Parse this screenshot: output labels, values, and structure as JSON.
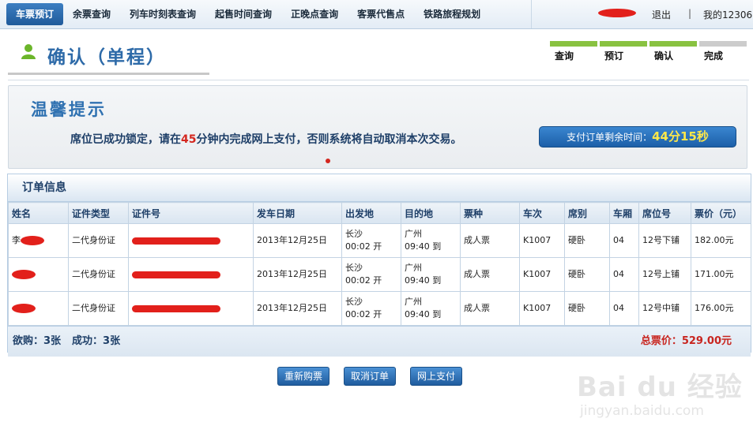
{
  "nav": {
    "items": [
      {
        "label": "车票预订",
        "active": true
      },
      {
        "label": "余票查询",
        "active": false
      },
      {
        "label": "列车时刻表查询",
        "active": false
      },
      {
        "label": "起售时间查询",
        "active": false
      },
      {
        "label": "正晚点查询",
        "active": false
      },
      {
        "label": "客票代售点",
        "active": false
      },
      {
        "label": "铁路旅程规划",
        "active": false
      }
    ],
    "logout": "退出",
    "separator": "|",
    "my": "我的12306"
  },
  "header": {
    "title": "确认（单程）",
    "steps": [
      {
        "label": "查询",
        "done": true
      },
      {
        "label": "预订",
        "done": true
      },
      {
        "label": "确认",
        "done": true
      },
      {
        "label": "完成",
        "done": false
      }
    ]
  },
  "tips": {
    "title": "温馨提示",
    "msg_before": "席位已成功锁定，请在",
    "minutes": "45",
    "msg_after": "分钟内完成网上支付，否则系统将自动取消本次交易。",
    "countdown_label": "支付订单剩余时间：",
    "countdown_time": "44分15秒"
  },
  "order": {
    "title": "订单信息",
    "columns": [
      "姓名",
      "证件类型",
      "证件号",
      "发车日期",
      "出发地",
      "目的地",
      "票种",
      "车次",
      "席别",
      "车厢",
      "席位号",
      "票价（元）"
    ],
    "rows": [
      {
        "name": "李",
        "id_type": "二代身份证",
        "date": "2013年12月25日",
        "from": "长沙",
        "from_time": "00:02 开",
        "to": "广州",
        "to_time": "09:40 到",
        "ticket_type": "成人票",
        "train": "K1007",
        "seat_class": "硬卧",
        "car": "04",
        "seat_no": "12号下铺",
        "price": "182.00元"
      },
      {
        "name": "",
        "id_type": "二代身份证",
        "date": "2013年12月25日",
        "from": "长沙",
        "from_time": "00:02 开",
        "to": "广州",
        "to_time": "09:40 到",
        "ticket_type": "成人票",
        "train": "K1007",
        "seat_class": "硬卧",
        "car": "04",
        "seat_no": "12号上铺",
        "price": "171.00元"
      },
      {
        "name": "",
        "id_type": "二代身份证",
        "date": "2013年12月25日",
        "from": "长沙",
        "from_time": "00:02 开",
        "to": "广州",
        "to_time": "09:40 到",
        "ticket_type": "成人票",
        "train": "K1007",
        "seat_class": "硬卧",
        "car": "04",
        "seat_no": "12号中铺",
        "price": "176.00元"
      }
    ],
    "want": "欲购：3张",
    "success": "成功：3张",
    "total": "总票价：529.00元"
  },
  "buttons": {
    "rebuy": "重新购票",
    "cancel": "取消订单",
    "pay": "网上支付"
  },
  "watermark": {
    "logo": "Bai du 经验",
    "url": "jingyan.baidu.com"
  },
  "colors": {
    "brand": "#2d6aa8",
    "step_done": "#89c241",
    "alert": "#d4271f",
    "countdown_time": "#ffe84a"
  }
}
